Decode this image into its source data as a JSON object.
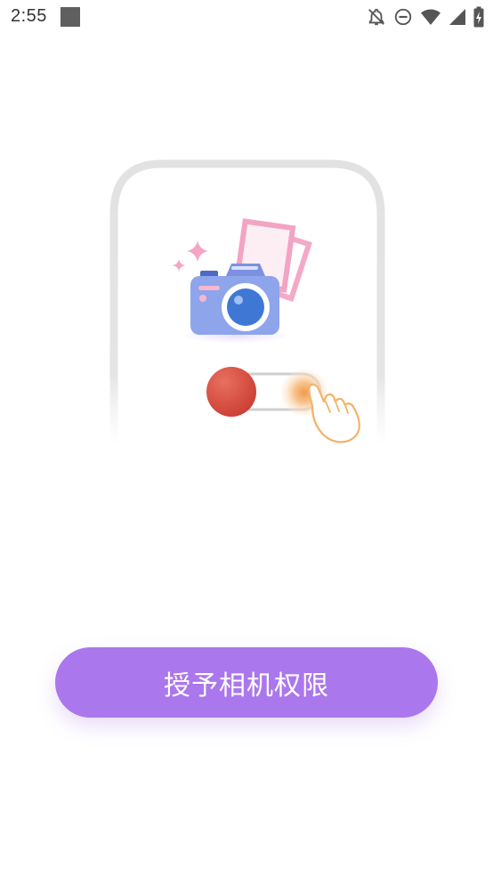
{
  "status_bar": {
    "time": "2:55",
    "icons": [
      "notifications-off-icon",
      "do-not-disturb-icon",
      "wifi-icon",
      "signal-icon",
      "battery-charging-icon"
    ]
  },
  "illustration": {
    "icons": [
      "camera-icon",
      "photo-stack-icon",
      "sparkle-icon",
      "toggle-switch-icon",
      "tap-hand-icon"
    ]
  },
  "action": {
    "grant_button_label": "授予相机权限"
  },
  "colors": {
    "accent": "#ab77ec",
    "camera_body": "#8ea5ec",
    "camera_lens": "#3f78d4",
    "photo_frame": "#f4a9c8",
    "toggle_knob": "#d94a3e",
    "hand_outline": "#f2b36b"
  }
}
